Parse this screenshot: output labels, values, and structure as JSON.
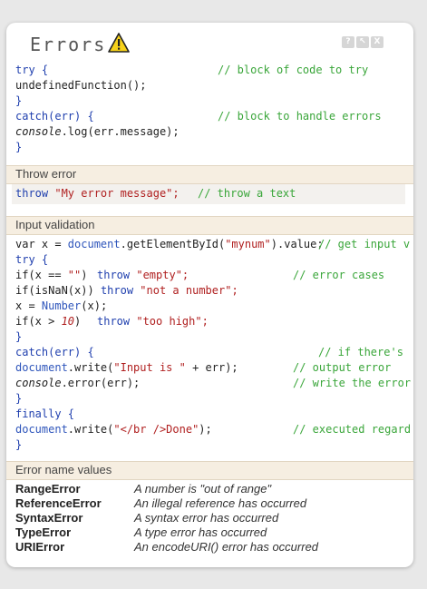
{
  "header": {
    "title": "Errors",
    "window_controls": [
      "?",
      "↖",
      "X"
    ]
  },
  "colors": {
    "keyword": "#1f3fae",
    "string": "#b02020",
    "comment": "#3aa63a",
    "section_bg": "#f6eee1"
  },
  "block1": {
    "l1": "try {",
    "l1_comment": "// block of code to try",
    "l2": "undefinedFunction();",
    "l3": "}",
    "l4": "catch(err) {",
    "l4_comment": "// block to handle errors",
    "l5_obj": "console",
    "l5_rest": ".log(err.message);",
    "l6": "}"
  },
  "throw_section": {
    "title": "Throw error",
    "kw": "throw",
    "str": "\"My error message\";",
    "comment": "// throw a text"
  },
  "input_section": {
    "title": "Input validation",
    "l1_a": "var x = ",
    "l1_doc": "document",
    "l1_b": ".getElementById(",
    "l1_str": "\"mynum\"",
    "l1_c": ").value;",
    "l1_comment": "// get input v",
    "l2": "try {",
    "l3_a": "if(x == ",
    "l3_str": "\"\"",
    "l3_b": ")",
    "l3_kw": "throw",
    "l3_str2": "\"empty\";",
    "l3_comment": "// error cases",
    "l4_a": "if(isNaN(x))",
    "l4_kw": "throw",
    "l4_str": "\"not a number\";",
    "l5_a": "x = ",
    "l5_fn": "Number",
    "l5_b": "(x);",
    "l6_a": "if(x > ",
    "l6_num": "10",
    "l6_b": ")",
    "l6_kw": "throw",
    "l6_str": "\"too high\";",
    "l7": "}",
    "l8": "catch(err) {",
    "l8_comment": "// if there's",
    "l9_doc": "document",
    "l9_a": ".write(",
    "l9_str": "\"Input is \"",
    "l9_b": " + err);",
    "l9_comment": "// output error",
    "l10_obj": "console",
    "l10_a": ".error(err);",
    "l10_comment": "// write the error",
    "l11": "}",
    "l12": "finally {",
    "l13_doc": "document",
    "l13_a": ".write(",
    "l13_str": "\"</br />Done\"",
    "l13_b": ");",
    "l13_comment": "// executed regard",
    "l14": "}"
  },
  "name_section": {
    "title": "Error name values",
    "rows": [
      {
        "name": "RangeError",
        "desc": "A number is \"out of range\""
      },
      {
        "name": "ReferenceError",
        "desc": "An illegal reference has occurred"
      },
      {
        "name": "SyntaxError",
        "desc": "A syntax error has occurred"
      },
      {
        "name": "TypeError",
        "desc": "A type error has occurred"
      },
      {
        "name": "URIError",
        "desc": "An encodeURI() error has occurred"
      }
    ]
  }
}
